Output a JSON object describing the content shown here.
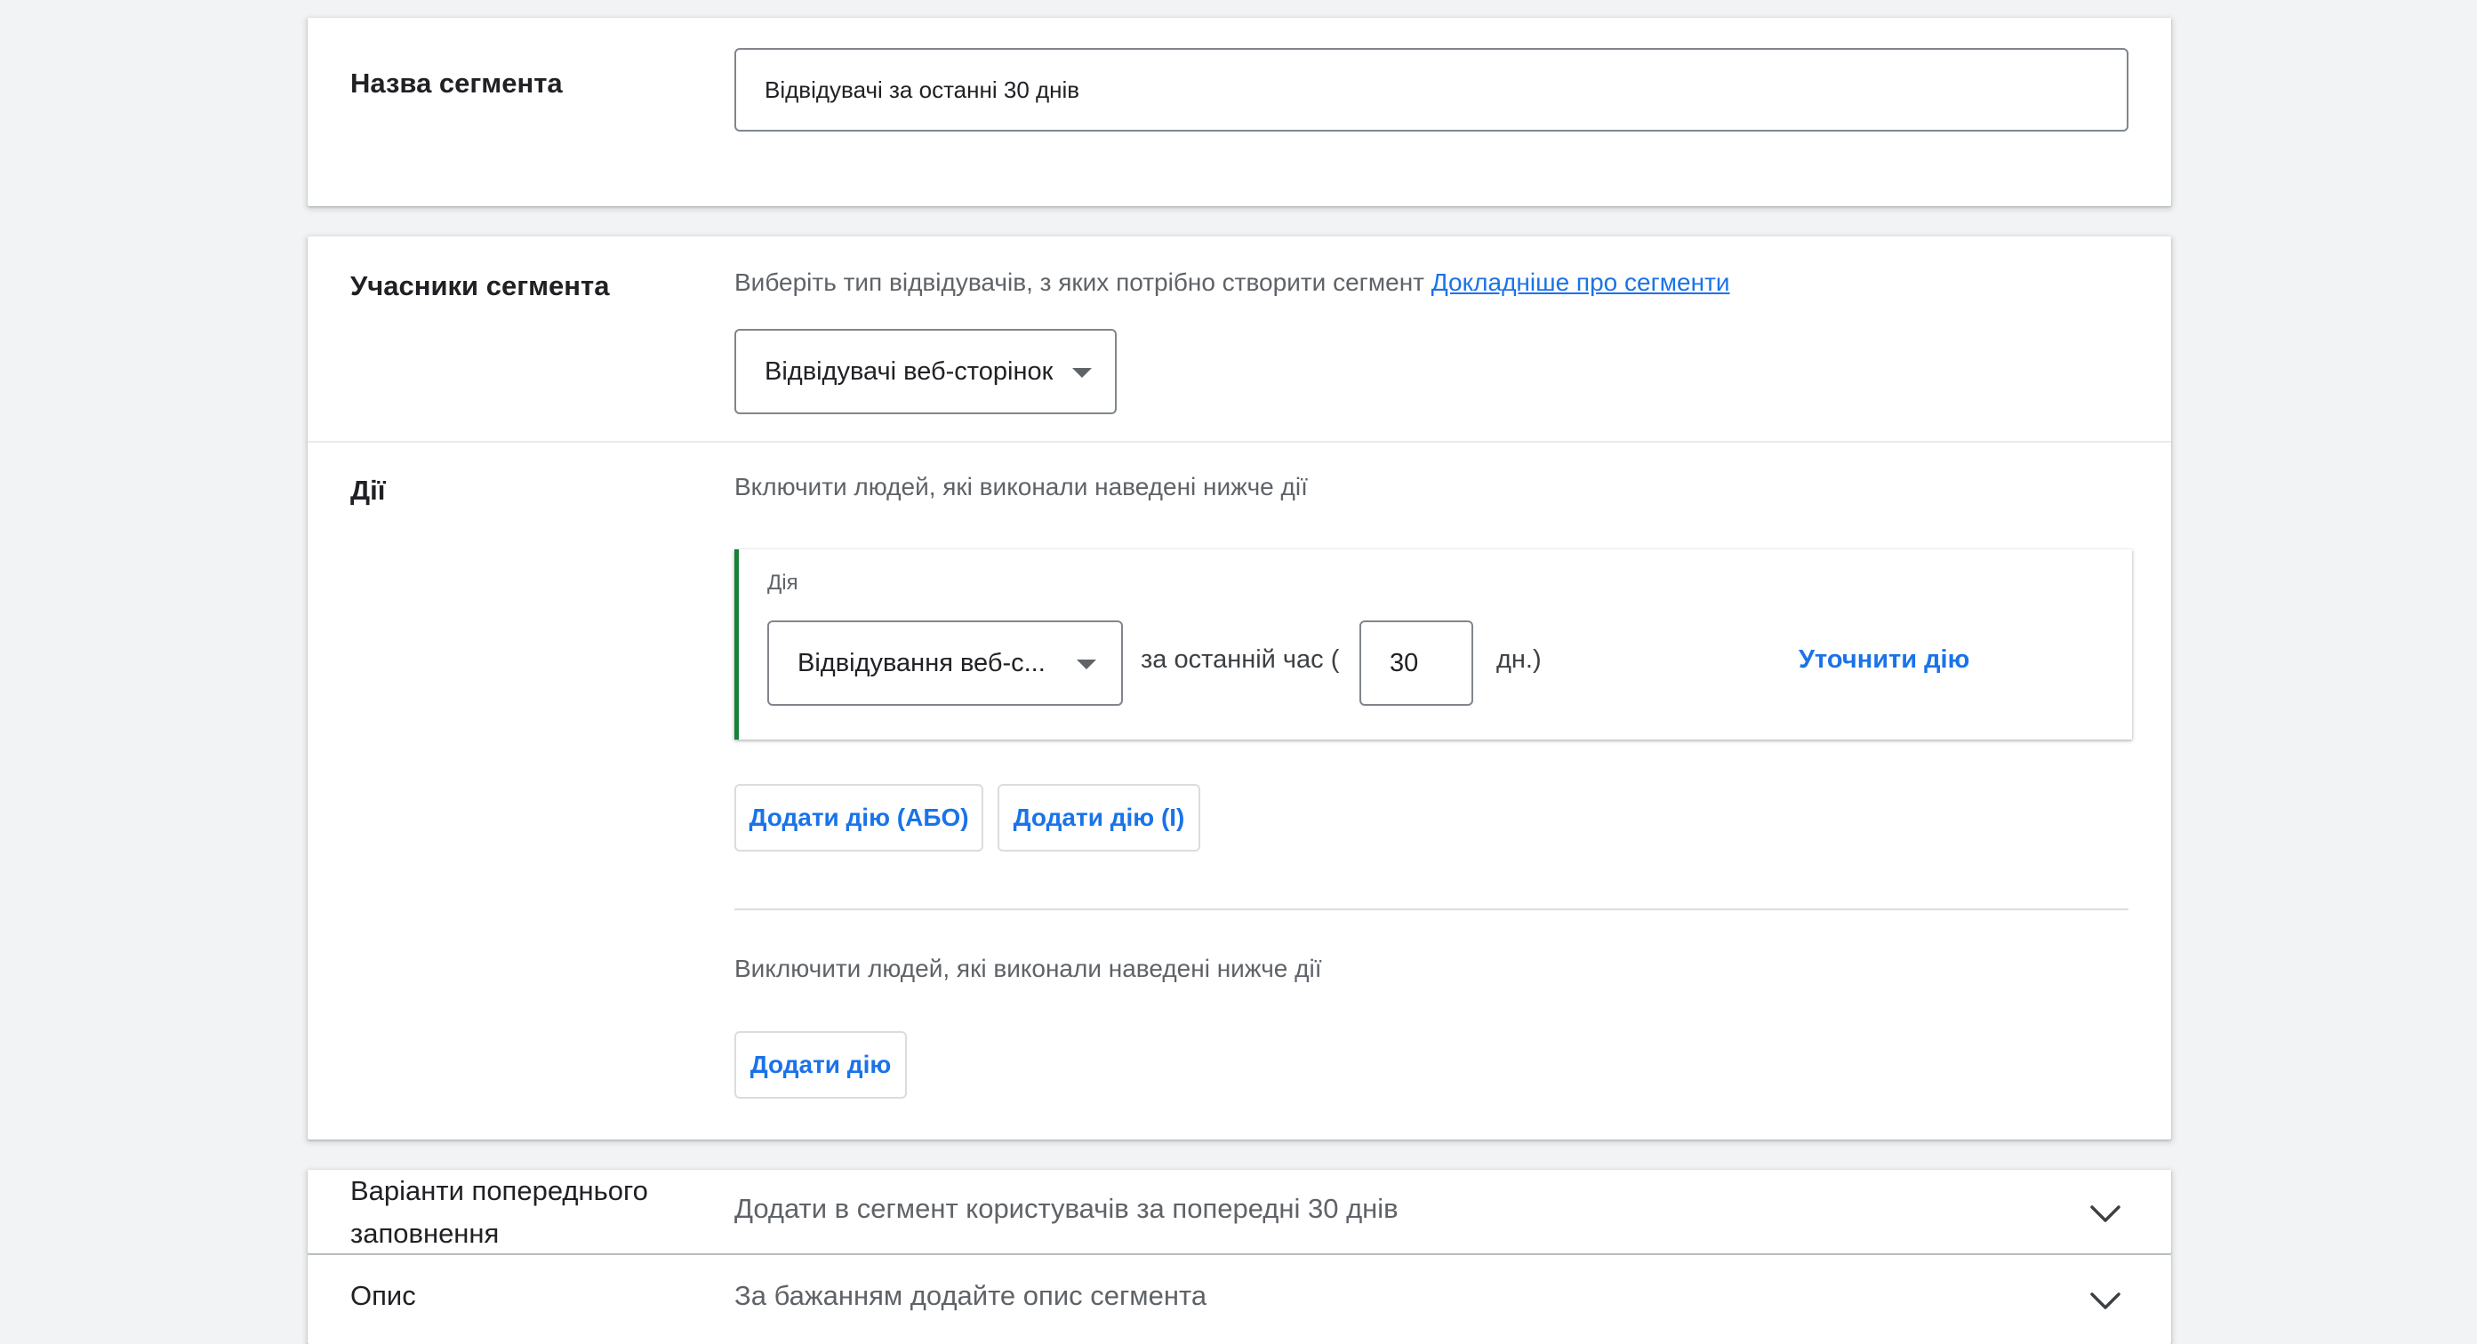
{
  "segment_name": {
    "label": "Назва сегмента",
    "value": "Відвідувачі за останні 30 днів"
  },
  "members": {
    "label": "Учасники сегмента",
    "hint": "Виберіть тип відвідувачів, з яких потрібно створити сегмент",
    "link": "Докладніше про сегменти",
    "type_selected": "Відвідувачі веб-сторінок"
  },
  "actions": {
    "label": "Дії",
    "include_text": "Включити людей, які виконали наведені нижче дії",
    "action_card": {
      "caption": "Дія",
      "action_selected": "Відвідування веб-с...",
      "time_prefix": "за останній час (",
      "days_value": "30",
      "days_suffix": "дн.)",
      "refine_label": "Уточнити дію"
    },
    "add_or_label": "Додати дію (АБО)",
    "add_and_label": "Додати дію (І)",
    "exclude_text": "Виключити людей, які виконали наведені нижче дії",
    "add_exclude_label": "Додати дію"
  },
  "prefill": {
    "label": "Варіанти попереднього заповнення",
    "value": "Додати в сегмент користувачів за попередні 30 днів"
  },
  "description": {
    "label": "Опис",
    "placeholder": "За бажанням додайте опис сегмента"
  },
  "colors": {
    "accent": "#1a73e8",
    "action_bar": "#188038",
    "background": "#f1f3f4"
  }
}
